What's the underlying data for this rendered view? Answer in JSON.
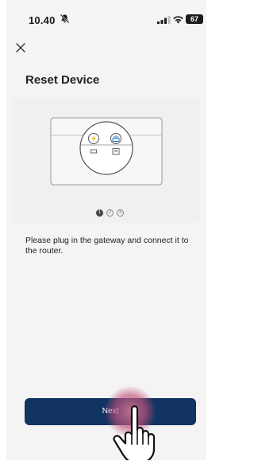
{
  "status_bar": {
    "time": "10.40",
    "battery": "67"
  },
  "header": {
    "close_icon": "close-icon",
    "title": "Reset Device"
  },
  "illustration": {
    "icons": [
      "power-bolt-icon",
      "router-icon"
    ]
  },
  "stepper": {
    "steps": [
      "1",
      "2",
      "3"
    ],
    "current": 1
  },
  "instruction": "Please plug in the gateway and connect it to the router.",
  "footer": {
    "next_label": "Next"
  },
  "colors": {
    "button": "#123462",
    "background": "#f4f4f4",
    "touch_highlight": "#c85a86"
  }
}
